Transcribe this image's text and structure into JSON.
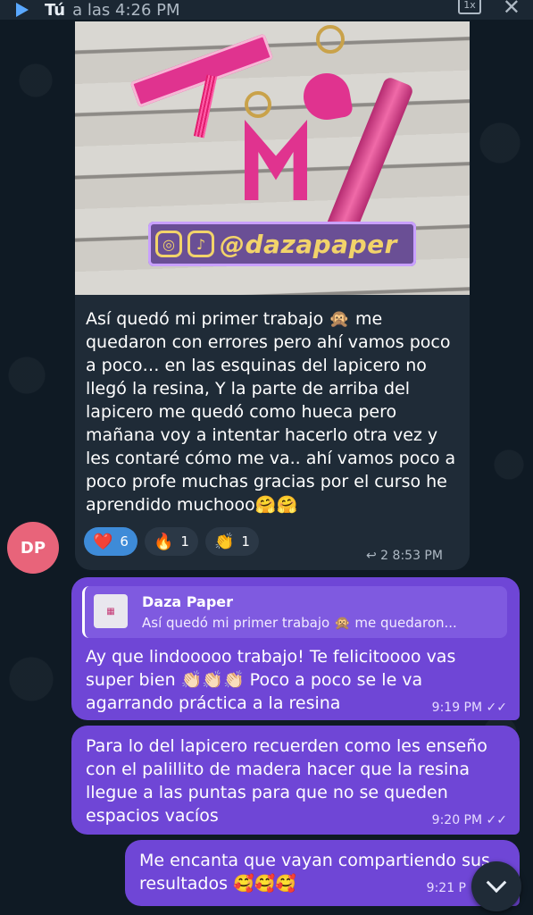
{
  "topbar": {
    "sender": "Tú",
    "time": "a las 4:26 PM",
    "download_label": "1x",
    "close_label": "✕"
  },
  "incoming": {
    "photo_handle": "@dazapaper",
    "text": "Así quedó mi primer trabajo 🙊 me quedaron con errores pero ahí vamos poco a poco… en las esquinas del lapicero no llegó la resina, Y la parte de arriba del lapicero me quedó como hueca pero mañana voy a intentar hacerlo otra vez y les contaré cómo me va.. ahí vamos poco a poco profe muchas gracias por el curso he aprendido muchooo🤗🤗",
    "reactions": [
      {
        "emoji": "❤️",
        "count": "6",
        "active": true
      },
      {
        "emoji": "🔥",
        "count": "1",
        "active": false
      },
      {
        "emoji": "👏",
        "count": "1",
        "active": false
      }
    ],
    "replies_count": "↩ 2",
    "time": "8:53 PM",
    "avatar_initials": "DP"
  },
  "outgoing": [
    {
      "reply_name": "Daza Paper",
      "reply_text": "Así quedó mi primer trabajo 🙊 me quedaron...",
      "text": "Ay que lindooooo trabajo! Te felicitoooo vas super bien 👏🏻👏🏻👏🏻 Poco a poco se le va agarrando práctica a la resina",
      "time": "9:19 PM ✓✓"
    },
    {
      "text": "Para lo del lapicero recuerden como les enseño con el palillito de madera hacer que la resina llegue a las puntas para que no se queden espacios vacíos",
      "time": "9:20 PM ✓✓"
    },
    {
      "text": "Me encanta que vayan compartiendo sus resultados 🥰🥰🥰",
      "time": "9:21 P"
    }
  ],
  "colors": {
    "background": "#0f1a24",
    "incoming_bubble": "#1f2b37",
    "outgoing_bubble": "#6f46d6",
    "reaction_active": "#3e8bd8",
    "avatar": "#e8647a"
  }
}
